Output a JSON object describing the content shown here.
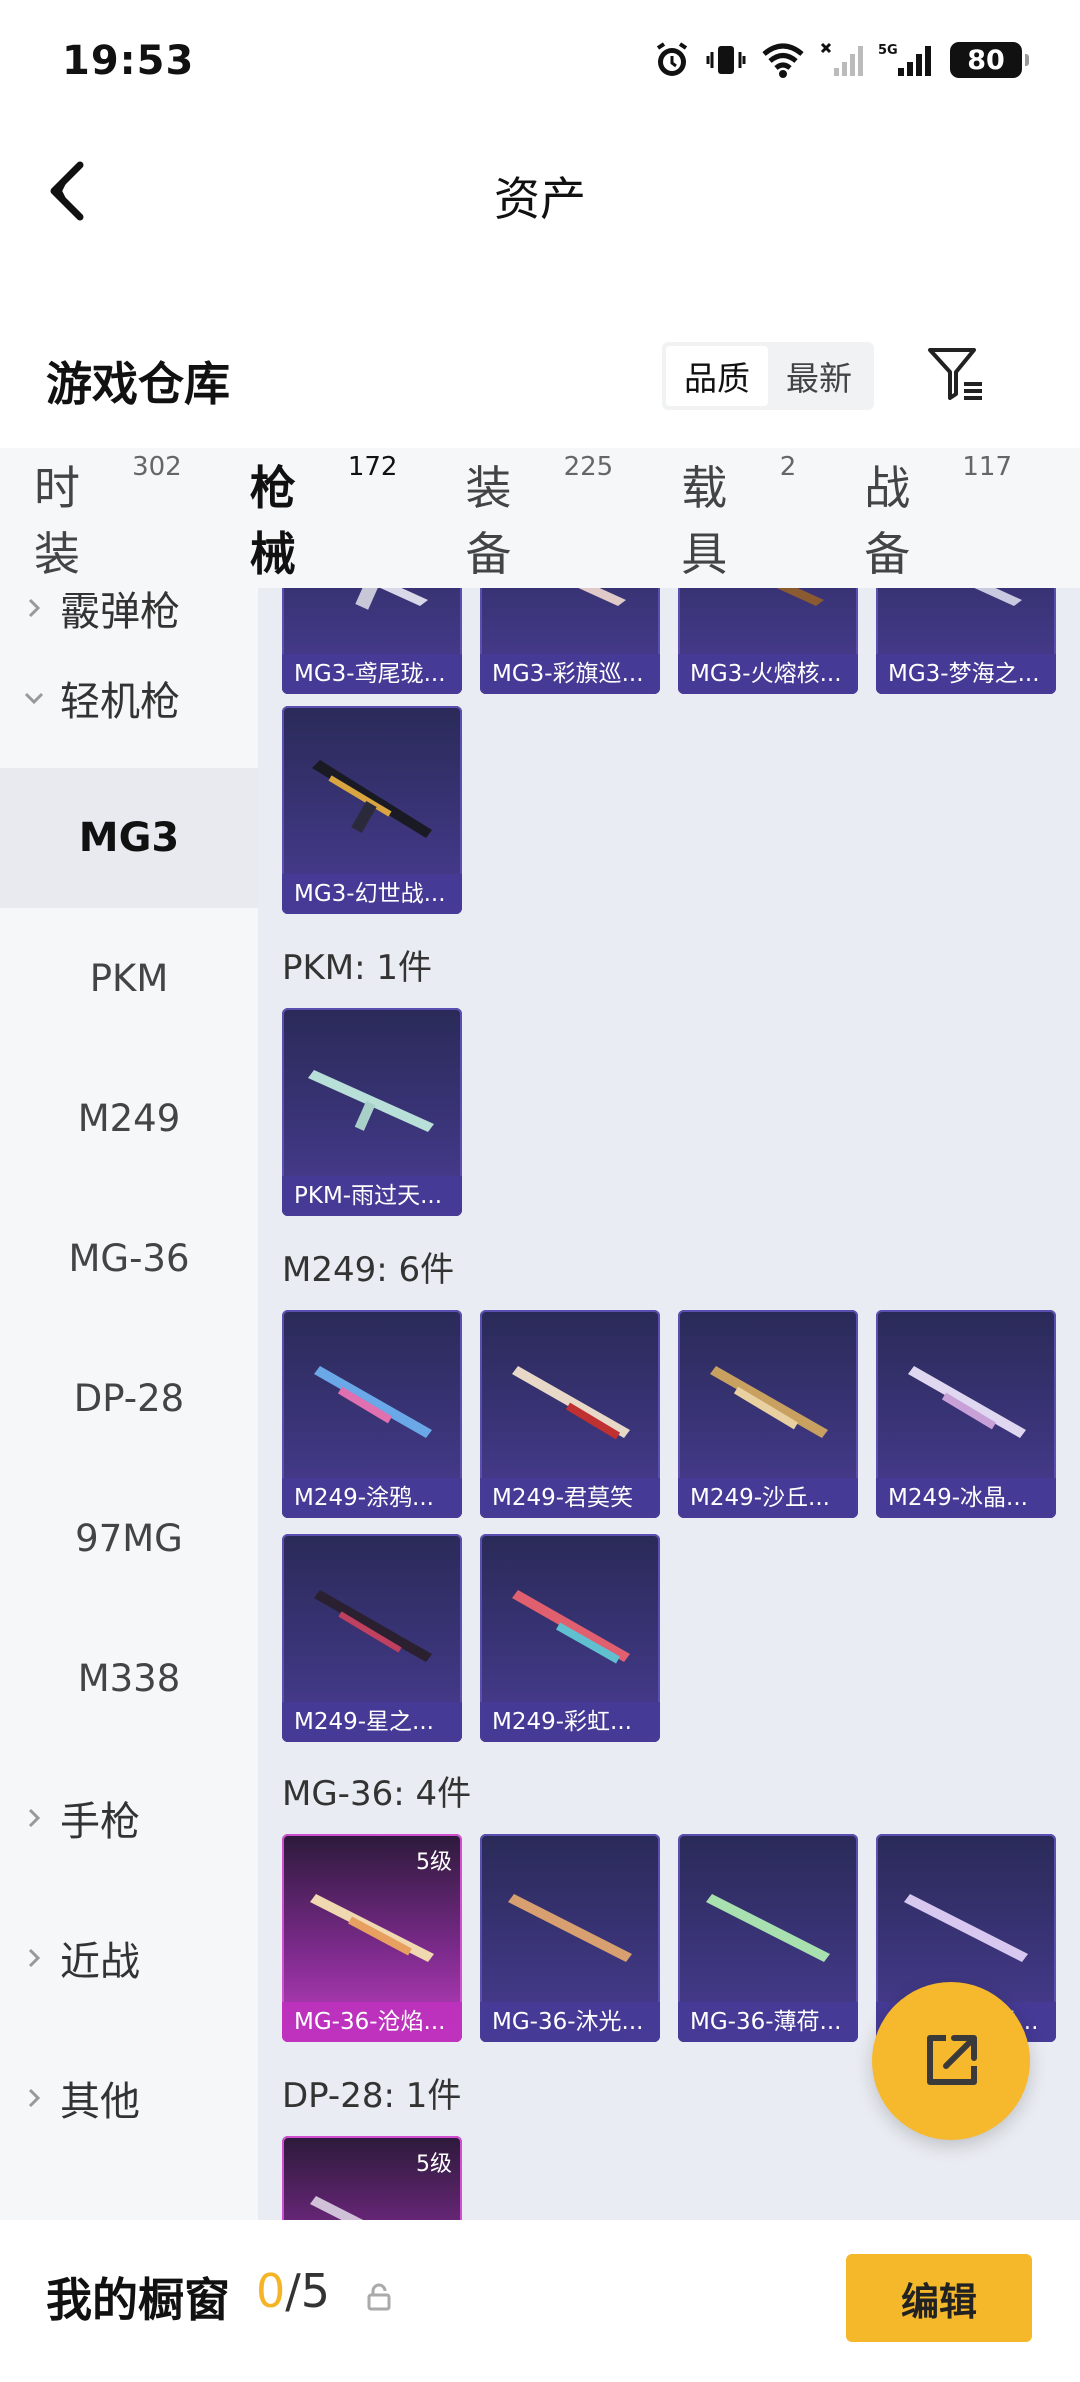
{
  "status_bar": {
    "time": "19:53",
    "battery": "80",
    "network": "5G"
  },
  "nav": {
    "title": "资产"
  },
  "section": {
    "title": "游戏仓库",
    "sort_options": [
      "品质",
      "最新"
    ],
    "sort_selected": "品质"
  },
  "tabs": [
    {
      "label": "时装",
      "count": "302"
    },
    {
      "label": "枪械",
      "count": "172",
      "active": true
    },
    {
      "label": "装备",
      "count": "225"
    },
    {
      "label": "载具",
      "count": "2"
    },
    {
      "label": "战备",
      "count": "117"
    }
  ],
  "sidebar": {
    "items": [
      {
        "label": "霰弹枪"
      },
      {
        "label": "轻机枪"
      },
      {
        "label": "MG3",
        "active": true
      },
      {
        "label": "PKM"
      },
      {
        "label": "M249"
      },
      {
        "label": "MG-36"
      },
      {
        "label": "DP-28"
      },
      {
        "label": "97MG"
      },
      {
        "label": "M338"
      },
      {
        "label": "手枪"
      },
      {
        "label": "近战"
      },
      {
        "label": "其他"
      }
    ]
  },
  "content": {
    "mg3_top": [
      "MG3-鸢尾珑...",
      "MG3-彩旗巡...",
      "MG3-火熔核...",
      "MG3-梦海之..."
    ],
    "mg3_more": [
      "MG3-幻世战..."
    ],
    "pkm_label": "PKM: 1件",
    "pkm_items": [
      "PKM-雨过天..."
    ],
    "m249_label": "M249: 6件",
    "m249_items": [
      "M249-涂鸦...",
      "M249-君莫笑",
      "M249-沙丘...",
      "M249-冰晶...",
      "M249-星之...",
      "M249-彩虹..."
    ],
    "mg36_label": "MG-36: 4件",
    "mg36_items": [
      "MG-36-沧焰...",
      "MG-36-沐光...",
      "MG-36-薄荷...",
      "MG-36-...雪..."
    ],
    "dp28_label": "DP-28: 1件",
    "level_badge": "5级"
  },
  "bottom": {
    "label": "我的橱窗",
    "used": "0",
    "total": "/5",
    "edit": "编辑"
  },
  "colors": {
    "accent": "#f5b425",
    "card_blue": "#3a3478",
    "card_purple": "#c03fc0"
  }
}
